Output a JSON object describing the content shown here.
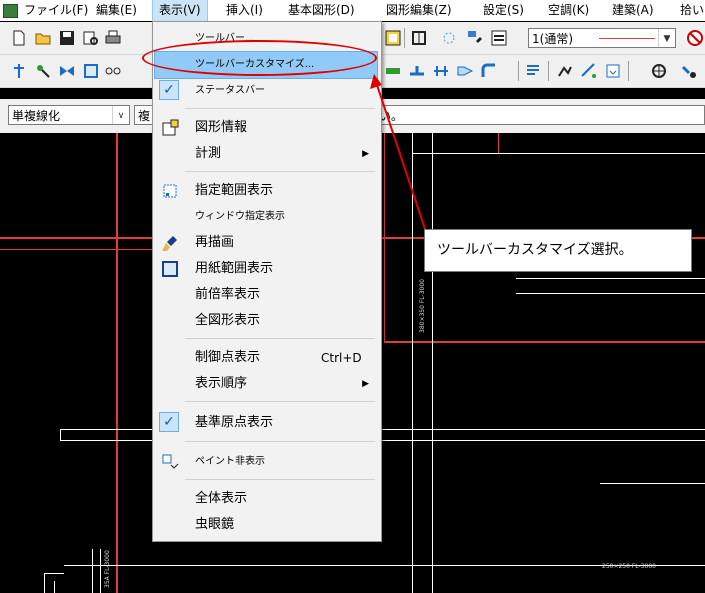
{
  "menubar": {
    "items": [
      "ファイル(F)",
      "編集(E)",
      "表示(V)",
      "挿入(I)",
      "基本図形(D)",
      "図形編集(Z)",
      "設定(S)",
      "空調(K)",
      "建築(A)",
      "拾い"
    ]
  },
  "toolbar": {
    "layer_combo": "1(通常)",
    "mode_combo": "単複線化",
    "mode_combo2": "複",
    "hint": "い。"
  },
  "menu": {
    "items": [
      {
        "label": "ツールバー..."
      },
      {
        "label": "ツールバーカスタマイズ..."
      },
      {
        "label": "ステータスバー"
      },
      {
        "label": "図形情報"
      },
      {
        "label": "計測"
      },
      {
        "label": "指定範囲表示"
      },
      {
        "label": "ウィンドウ指定表示"
      },
      {
        "label": "再描画"
      },
      {
        "label": "用紙範囲表示"
      },
      {
        "label": "前倍率表示"
      },
      {
        "label": "全図形表示"
      },
      {
        "label": "制御点表示",
        "shortcut": "Ctrl+D"
      },
      {
        "label": "表示順序"
      },
      {
        "label": "基準原点表示"
      },
      {
        "label": "ペイント非表示"
      },
      {
        "label": "全体表示"
      },
      {
        "label": "虫眼鏡"
      }
    ],
    "submenu_arrow": "▶",
    "check_mark": "✓"
  },
  "callout": {
    "text": "ツールバーカスタマイズ選択。"
  },
  "canvas": {
    "labels": [
      "380×350 FL-3000",
      "250×250 FL-3000",
      "35A FL-3000"
    ]
  },
  "colors": {
    "accent": "#e00000",
    "highlight": "#91c9f7",
    "canvas": "#000000"
  }
}
